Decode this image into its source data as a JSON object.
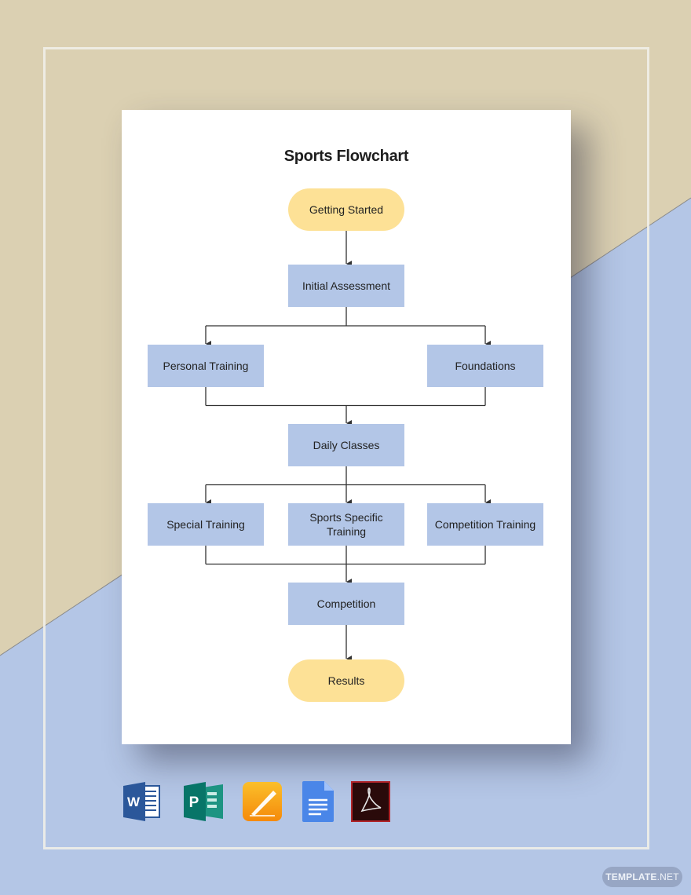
{
  "background": {
    "top_color": "#dbd0b2",
    "bottom_color": "#b4c6e6"
  },
  "document": {
    "title": "Sports Flowchart",
    "colors": {
      "terminal_fill": "#fde196",
      "process_fill": "#b3c6e7",
      "connector": "#333333"
    },
    "nodes": [
      {
        "id": "getting-started",
        "label": [
          "Getting Started"
        ],
        "shape": "terminal"
      },
      {
        "id": "initial-assessment",
        "label": [
          "Initial Assessment"
        ],
        "shape": "process"
      },
      {
        "id": "personal-training",
        "label": [
          "Personal Training"
        ],
        "shape": "process"
      },
      {
        "id": "foundations",
        "label": [
          "Foundations"
        ],
        "shape": "process"
      },
      {
        "id": "daily-classes",
        "label": [
          "Daily Classes"
        ],
        "shape": "process"
      },
      {
        "id": "special-training",
        "label": [
          "Special Training"
        ],
        "shape": "process"
      },
      {
        "id": "sports-specific-training",
        "label": [
          "Sports Specific",
          "Training"
        ],
        "shape": "process"
      },
      {
        "id": "competition-training",
        "label": [
          "Competition Training"
        ],
        "shape": "process"
      },
      {
        "id": "competition",
        "label": [
          "Competition"
        ],
        "shape": "process"
      },
      {
        "id": "results",
        "label": [
          "Results"
        ],
        "shape": "terminal"
      }
    ],
    "edges": [
      {
        "from": "getting-started",
        "to": "initial-assessment"
      },
      {
        "from": "initial-assessment",
        "to": "personal-training"
      },
      {
        "from": "initial-assessment",
        "to": "foundations"
      },
      {
        "from": "personal-training",
        "to": "daily-classes"
      },
      {
        "from": "foundations",
        "to": "daily-classes"
      },
      {
        "from": "daily-classes",
        "to": "special-training"
      },
      {
        "from": "daily-classes",
        "to": "sports-specific-training"
      },
      {
        "from": "daily-classes",
        "to": "competition-training"
      },
      {
        "from": "special-training",
        "to": "competition"
      },
      {
        "from": "sports-specific-training",
        "to": "competition"
      },
      {
        "from": "competition-training",
        "to": "competition"
      },
      {
        "from": "competition",
        "to": "results"
      }
    ]
  },
  "format_icons": [
    {
      "name": "microsoft-word-icon",
      "letter": "W",
      "color": "#2b579a"
    },
    {
      "name": "microsoft-publisher-icon",
      "letter": "P",
      "color": "#077568"
    },
    {
      "name": "apple-pages-icon",
      "letter": "",
      "color": "#f7a21b"
    },
    {
      "name": "google-docs-icon",
      "letter": "",
      "color": "#4a86e8"
    },
    {
      "name": "adobe-acrobat-icon",
      "letter": "",
      "color": "#2a0a0a"
    }
  ],
  "watermark": {
    "brand": "TEMPLATE",
    "suffix": ".NET"
  }
}
